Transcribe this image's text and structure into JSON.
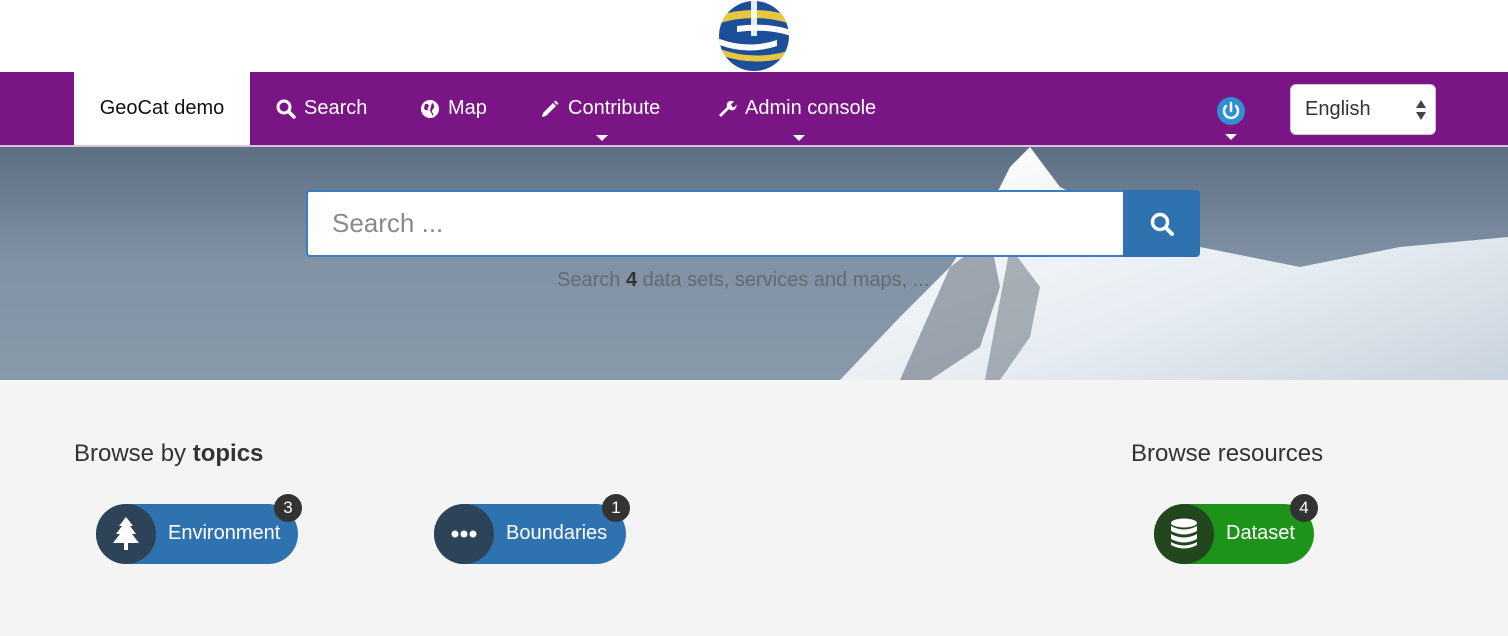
{
  "header": {
    "logo_icon": "geocat-globe-logo"
  },
  "nav": {
    "brand": "GeoCat demo",
    "items": [
      {
        "label": "Search",
        "icon": "search-icon"
      },
      {
        "label": "Map",
        "icon": "globe-icon"
      },
      {
        "label": "Contribute",
        "icon": "pencil-icon"
      },
      {
        "label": "Admin console",
        "icon": "wrench-icon"
      }
    ],
    "user_icon": "power-icon",
    "language": "English",
    "accent": "#7a1585"
  },
  "hero": {
    "search_placeholder": "Search ...",
    "caption_prefix": "Search",
    "caption_count": "4",
    "caption_suffix": "data sets, services and maps, ..."
  },
  "browse_topics": {
    "title_prefix": "Browse by",
    "title_bold": "topics",
    "items": [
      {
        "label": "Environment",
        "count": "3",
        "icon": "tree-icon"
      },
      {
        "label": "Boundaries",
        "count": "1",
        "icon": "ellipsis-icon"
      }
    ]
  },
  "browse_resources": {
    "title": "Browse resources",
    "items": [
      {
        "label": "Dataset",
        "count": "4",
        "icon": "database-icon"
      }
    ]
  }
}
